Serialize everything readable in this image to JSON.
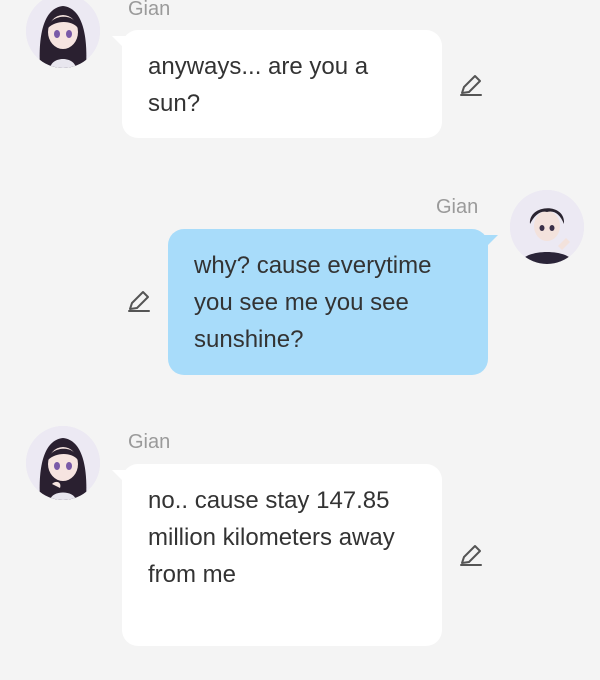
{
  "messages": [
    {
      "sender": "Gian",
      "side": "left",
      "text": "anyways... are you a sun?",
      "avatar_icon": "girl-avatar-icon"
    },
    {
      "sender": "Gian",
      "side": "right",
      "text": "why? cause everytime you see me you see sunshine?",
      "avatar_icon": "boy-avatar-icon"
    },
    {
      "sender": "Gian",
      "side": "left",
      "text": "no.. cause stay 147.85 million kilometers away from me",
      "avatar_icon": "girl-avatar-icon"
    }
  ],
  "icons": {
    "edit": "pencil-edit-icon"
  },
  "colors": {
    "background": "#f4f4f4",
    "left_bubble": "#ffffff",
    "right_bubble": "#a8dcfa",
    "name_text": "#9a9a9a",
    "message_text": "#333333"
  }
}
